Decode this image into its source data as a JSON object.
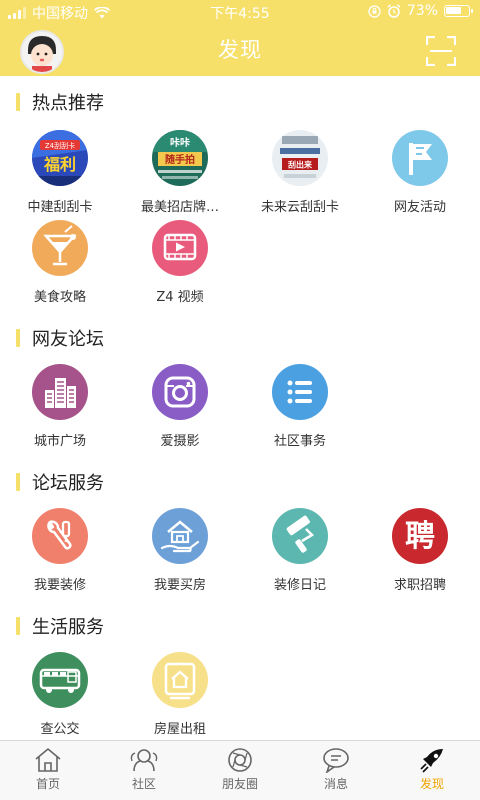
{
  "status_bar": {
    "carrier": "中国移动",
    "time": "下午4:55",
    "battery": "73%",
    "battery_level": 0.73,
    "icons": [
      "signal-icon",
      "wifi-icon",
      "lock-rotation-icon",
      "alarm-icon",
      "battery-icon"
    ]
  },
  "header": {
    "title": "发现",
    "background_color": "#f7e06a",
    "avatar_icon": "user-avatar",
    "scan_icon": "scan-icon"
  },
  "sections": [
    {
      "title": "热点推荐",
      "items": [
        {
          "label": "中建刮刮卡",
          "icon": "zhongjian-scratch-card-image"
        },
        {
          "label": "最美招店牌…",
          "icon": "shop-sign-image"
        },
        {
          "label": "未来云刮刮卡",
          "icon": "future-cloud-scratch-card-image"
        },
        {
          "label": "网友活动",
          "icon": "flag-icon",
          "color": "#7ec8ea"
        },
        {
          "label": "美食攻略",
          "icon": "cocktail-icon",
          "color": "#f0aa5a"
        },
        {
          "label": "Z4 视频",
          "icon": "video-icon",
          "color": "#e85b7d"
        }
      ]
    },
    {
      "title": "网友论坛",
      "items": [
        {
          "label": "城市广场",
          "icon": "city-buildings-icon",
          "color": "#a5538a"
        },
        {
          "label": "爱摄影",
          "icon": "camera-icon",
          "color": "#8a5cc6"
        },
        {
          "label": "社区事务",
          "icon": "list-icon",
          "color": "#4aa0e0"
        }
      ]
    },
    {
      "title": "论坛服务",
      "items": [
        {
          "label": "我要装修",
          "icon": "wrench-icon",
          "color": "#f0806c"
        },
        {
          "label": "我要买房",
          "icon": "house-hand-icon",
          "color": "#6ea0d8"
        },
        {
          "label": "装修日记",
          "icon": "paint-roller-icon",
          "color": "#5cb7b0"
        },
        {
          "label": "求职招聘",
          "icon": "hire-icon",
          "color": "#c8282e",
          "glyph": "聘"
        }
      ]
    },
    {
      "title": "生活服务",
      "items": [
        {
          "label": "查公交",
          "icon": "bus-icon",
          "color": "#3f8f5e"
        },
        {
          "label": "房屋出租",
          "icon": "house-rent-icon",
          "color": "#f7e08a"
        }
      ]
    }
  ],
  "tabbar": {
    "tabs": [
      {
        "label": "首页",
        "icon": "home-icon"
      },
      {
        "label": "社区",
        "icon": "community-icon"
      },
      {
        "label": "朋友圈",
        "icon": "moments-icon"
      },
      {
        "label": "消息",
        "icon": "message-icon"
      },
      {
        "label": "发现",
        "icon": "rocket-icon",
        "active": true
      }
    ],
    "active_color": "#f0a500"
  }
}
